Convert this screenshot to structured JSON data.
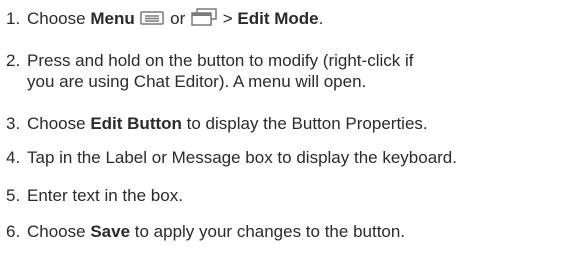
{
  "steps": [
    {
      "number": "1.",
      "before_icon1": "Choose ",
      "bold1": "Menu",
      "icon1": "menu-icon",
      "between": " or ",
      "icon2": "recent-apps-icon",
      "after_icon2": " > ",
      "bold2": "Edit Mode",
      "end": "."
    },
    {
      "number": "2.",
      "line1": "Press and hold on the button to modify (right-click if",
      "line2": "you are using Chat Editor). A menu will open."
    },
    {
      "number": "3.",
      "before": "Choose ",
      "bold": "Edit Button",
      "after": " to display the Button Properties."
    },
    {
      "number": "4.",
      "text": "Tap in the Label or Message box to display the keyboard."
    },
    {
      "number": "5.",
      "text": "Enter text in the box."
    },
    {
      "number": "6.",
      "before": "Choose ",
      "bold": "Save",
      "after": " to apply your changes to the button."
    }
  ],
  "colors": {
    "text": "#2b2b2b",
    "icon": "#7a7a7a"
  }
}
